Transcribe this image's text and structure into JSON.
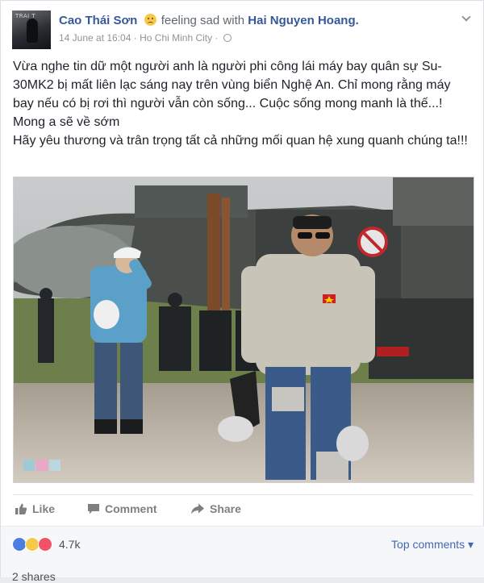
{
  "header": {
    "author": "Cao Thái Sơn",
    "feeling": "feeling sad with",
    "friend": "Hai Nguyen Hoang.",
    "date": "14 June at 16:04",
    "location": "Ho Chi Minh City",
    "separator": "·",
    "avatar_text": "TRAI T"
  },
  "post": {
    "line1": "Vừa nghe tin dữ một người anh là người phi công lái máy bay quân sự Su-30MK2 bị mất liên lạc sáng nay trên vùng biển Nghệ An. Chỉ mong rằng máy bay nếu có bị rơi thì người vẫn còn sống... Cuộc sống mong manh là thế...!",
    "line2": "Mong a sẽ về sớm",
    "line3": "Hãy yêu thương và trân trọng tất cả những mối quan hệ xung quanh chúng ta!!!"
  },
  "actions": {
    "like": "Like",
    "comment": "Comment",
    "share": "Share"
  },
  "reactions": {
    "count": "4.7k",
    "top_comments": "Top comments",
    "shares": "2 shares"
  },
  "colors": {
    "link": "#365899",
    "accent": "#4267b2",
    "muted": "#90949c"
  }
}
